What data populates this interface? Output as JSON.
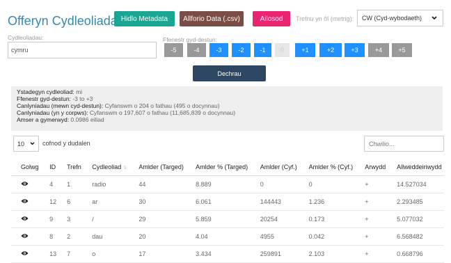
{
  "header": {
    "title": "Offeryn Cydleoliadau",
    "btn_metadata": "Hidlo Metadata",
    "btn_export": "Allforio Data (.csv)",
    "btn_reset": "Ailosod",
    "sort_label": "Trefnu yn ôl (metrig):",
    "sort_value": "CW (Cyd-wybodaeth)",
    "colors": {
      "metadata": "#1aa692",
      "export": "#7a4e46",
      "reset": "#ea2470"
    }
  },
  "form": {
    "term_label": "Cydleoliadau:",
    "term_value": "cymru",
    "window_label": "Ffenestr gyd-destun:",
    "window_buttons": [
      "-5",
      "-4",
      "-3",
      "-2",
      "-1",
      "0",
      "+1",
      "+2",
      "+3",
      "+4",
      "+5"
    ],
    "start_button": "Dechrau"
  },
  "stats": {
    "lines": [
      {
        "k": "Ystadegyn cydleoliad:",
        "v": " mi"
      },
      {
        "k": "Ffenestr gyd-destun:",
        "v": " -3 to +3"
      },
      {
        "k": "Canlyniadau (mewn cyd-destun):",
        "v": " Cyfanswm o 204 o fathau (495 o docynnau)"
      },
      {
        "k": "Canlyniadau (yn y corpws):",
        "v": " Cyfanswm o 197,607 o fathau (11,685,839 o docynnau)"
      },
      {
        "k": "Amser a gymerwyd:",
        "v": " 0.0986 eiliad"
      }
    ]
  },
  "table_controls": {
    "page_size": "10",
    "page_size_suffix": "cofnod y dudalen",
    "search_placeholder": "Chwilio..."
  },
  "table": {
    "headers": [
      "Golwg",
      "ID",
      "Trefn",
      "Cydleoliad",
      "Amlder (Targed)",
      "Amlder % (Targed)",
      "Amlder (Cyf.)",
      "Amlder % (Cyf.)",
      "Arwydd",
      "Allweddeiriwydd"
    ],
    "rows": [
      [
        "4",
        "1",
        "radio",
        "44",
        "8.889",
        "0",
        "0",
        "+",
        "14.527034"
      ],
      [
        "12",
        "6",
        "ar",
        "30",
        "6.061",
        "144443",
        "1.236",
        "+",
        "2.293485"
      ],
      [
        "9",
        "3",
        "/",
        "29",
        "5.859",
        "20254",
        "0.173",
        "+",
        "5.077032"
      ],
      [
        "8",
        "2",
        "dau",
        "20",
        "4.04",
        "4955",
        "0.042",
        "+",
        "6.568482"
      ],
      [
        "13",
        "7",
        "o",
        "17",
        "3.434",
        "259891",
        "2.103",
        "+",
        "0.668796"
      ]
    ]
  },
  "icons": {
    "view": "eye-icon",
    "sort": "sort-icon",
    "dropdown": "chevron-down-icon"
  }
}
